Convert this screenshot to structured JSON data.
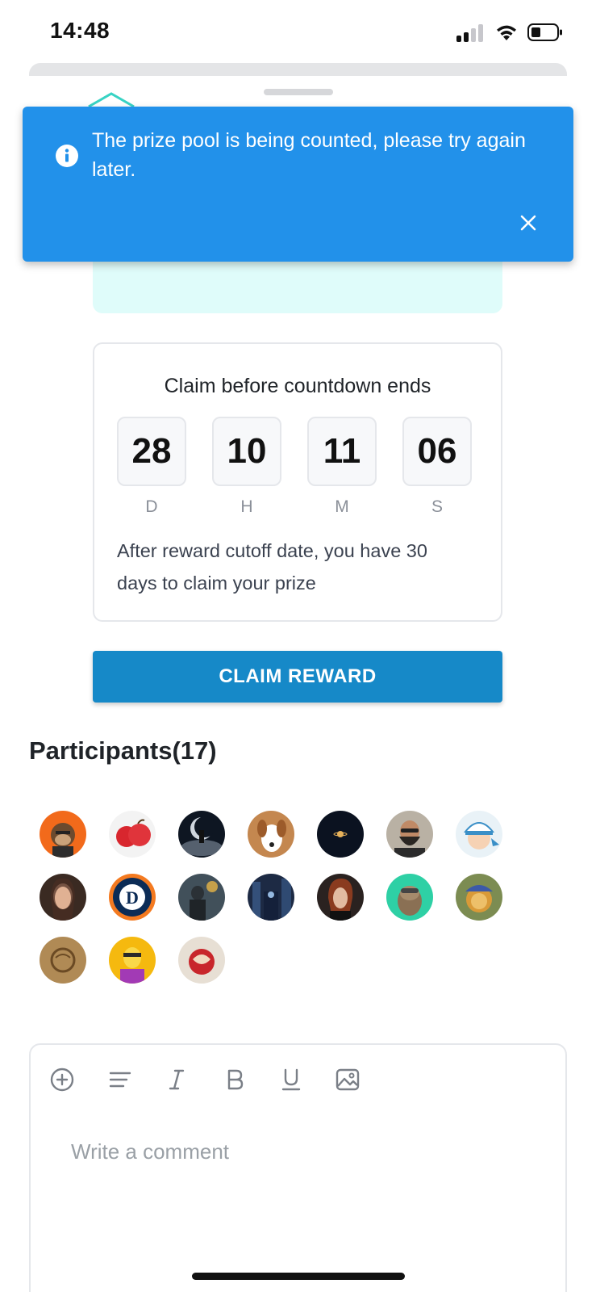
{
  "status_bar": {
    "time": "14:48"
  },
  "toast": {
    "message": "The prize pool is being counted, please try again later."
  },
  "countdown": {
    "title": "Claim before countdown ends",
    "values": {
      "days": "28",
      "hours": "10",
      "minutes": "11",
      "seconds": "06"
    },
    "units": {
      "days": "D",
      "hours": "H",
      "minutes": "M",
      "seconds": "S"
    },
    "note": "After reward cutoff date, you have 30 days to claim your prize"
  },
  "claim_button": {
    "label": "CLAIM REWARD"
  },
  "participants": {
    "title": "Participants(17)",
    "avatars": [
      "ape-orange-avatar",
      "apple-avatar",
      "moon-avatar",
      "dog-avatar",
      "planet-avatar",
      "bearded-man-avatar",
      "cartoon-cap-avatar",
      "woman-portrait-avatar",
      "detroit-tigers-avatar",
      "soldier-avatar",
      "city-night-avatar",
      "woman-redhair-avatar",
      "otter-avatar",
      "lion-avatar",
      "wood-carving-avatar",
      "yellow-cartoon-avatar",
      "red-dragon-avatar"
    ]
  },
  "comment": {
    "placeholder": "Write a comment",
    "toolbar": [
      "add-icon",
      "align-icon",
      "italic-icon",
      "bold-icon",
      "underline-icon",
      "image-icon"
    ]
  },
  "colors": {
    "toast_bg": "#2291ea",
    "claim_button_bg": "#1689c8",
    "prize_box_bg": "#dffcfa"
  }
}
